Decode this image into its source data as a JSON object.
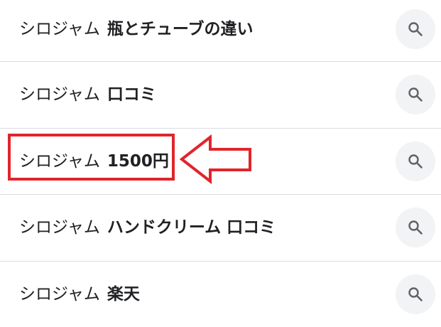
{
  "suggestions": [
    {
      "prefix": "シロジャム",
      "suffix": "瓶とチューブの違い",
      "action_icon": "search-icon"
    },
    {
      "prefix": "シロジャム",
      "suffix": "口コミ",
      "action_icon": "search-icon"
    },
    {
      "prefix": "シロジャム",
      "suffix": "1500円",
      "action_icon": "search-icon"
    },
    {
      "prefix": "シロジャム",
      "suffix": "ハンドクリーム 口コミ",
      "action_icon": "search-icon"
    },
    {
      "prefix": "シロジャム",
      "suffix": "楽天",
      "action_icon": "search-icon"
    }
  ],
  "annotation": {
    "highlighted_index": 2,
    "highlight_color": "#e0252c",
    "arrow_icon": "left-arrow-icon"
  },
  "colors": {
    "text": "#202124",
    "divider": "#dadce0",
    "search_button_bg": "#f1f3f4",
    "search_icon": "#5f6368"
  }
}
